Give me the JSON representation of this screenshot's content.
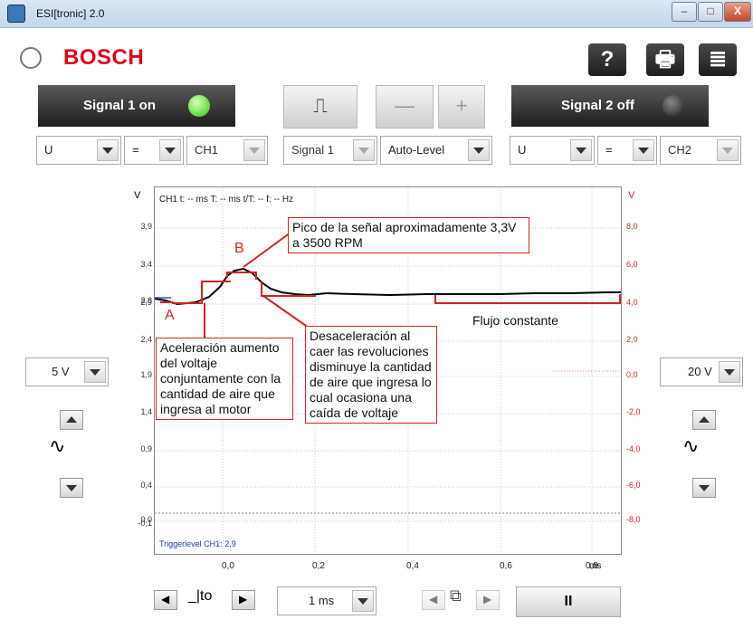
{
  "window": {
    "title": "ESI[tronic] 2.0",
    "minimize": "–",
    "maximize": "□",
    "close": "X"
  },
  "header": {
    "brand": "BOSCH",
    "help": "?",
    "print": "🖶",
    "menu": "≣"
  },
  "signal1": {
    "label": "Signal 1 on",
    "led_color": "#6fe04a"
  },
  "signal2": {
    "label": "Signal 2 off",
    "led_color": "#444444"
  },
  "toolbar": {
    "trigger": "⎍",
    "minus": "—",
    "plus": "+"
  },
  "dropdowns": {
    "ch1_mode": "U",
    "ch1_cmp": "=",
    "ch1_channel": "CH1",
    "signal": "Signal 1",
    "level": "Auto-Level",
    "ch2_mode": "U",
    "ch2_cmp": "=",
    "ch2_channel": "CH2"
  },
  "plot": {
    "left_unit": "V",
    "right_unit": "V",
    "readout": "CH1  t: -- ms   T: -- ms   t/T: --   f: -- Hz",
    "trigger_level": "Triggerlevel CH1: 2,9",
    "left_ticks": [
      "3,9",
      "3,4",
      "2,9",
      "2,4",
      "1,9",
      "1,4",
      "0,9",
      "0,4",
      "0,0"
    ],
    "left_ticks_extra": [
      "2,8",
      "-0,1"
    ],
    "right_ticks": [
      "8,0",
      "6,0",
      "4,0",
      "2,0",
      "0,0",
      "-2,0",
      "-4,0",
      "-6,0",
      "-8,0"
    ],
    "x_ticks": [
      "0,0",
      "0,2",
      "0,4",
      "0,6",
      "0,8"
    ],
    "x_unit": "ms",
    "annotations": {
      "A": "A",
      "B": "B",
      "peak": "Pico de la señal aproximadamente 3,3V  a 3500 RPM",
      "accel": "Aceleración aumento del voltaje conjuntamente con la cantidad de aire que ingresa al motor",
      "decel": "Desaceleración al caer las revoluciones disminuye la cantidad de aire que ingresa lo cual ocasiona una caída de voltaje",
      "flow": "Flujo constante"
    }
  },
  "left_scale": "5 V",
  "right_scale": "20 V",
  "bottom": {
    "trigger_marker": "_|to",
    "timebase": "1 ms",
    "pause": "II"
  },
  "colors": {
    "signal_line": "#000000",
    "annotation": "#d22222",
    "grid": "#c9c9c9",
    "right_axis": "#d22222"
  }
}
